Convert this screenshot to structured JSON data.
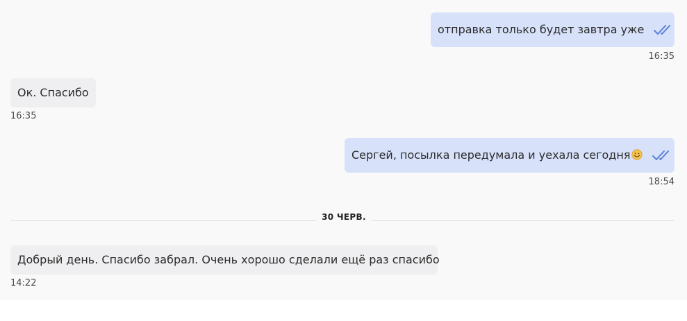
{
  "messages": [
    {
      "direction": "outgoing",
      "text": "отправка только будет завтра уже",
      "time": "16:35",
      "status_icon": "double-check-icon"
    },
    {
      "direction": "incoming",
      "text": "Ок. Спасибо",
      "time": "16:35"
    },
    {
      "direction": "outgoing",
      "text": "Сергей, посылка передумала и уехала сегодня",
      "emoji": "smiling-face-emoji",
      "time": "18:54",
      "status_icon": "double-check-icon"
    },
    {
      "direction": "incoming",
      "text": "Добрый день. Спасибо забрал. Очень хорошо сделали ещё раз спасибо",
      "time": "14:22"
    }
  ],
  "date_separator": {
    "label": "30 ЧЕРВ."
  },
  "colors": {
    "outgoing_bubble": "#d7e2fa",
    "incoming_bubble": "#efeff1",
    "check_icon": "#5b7fd6",
    "chat_background": "#f9f9fa"
  }
}
